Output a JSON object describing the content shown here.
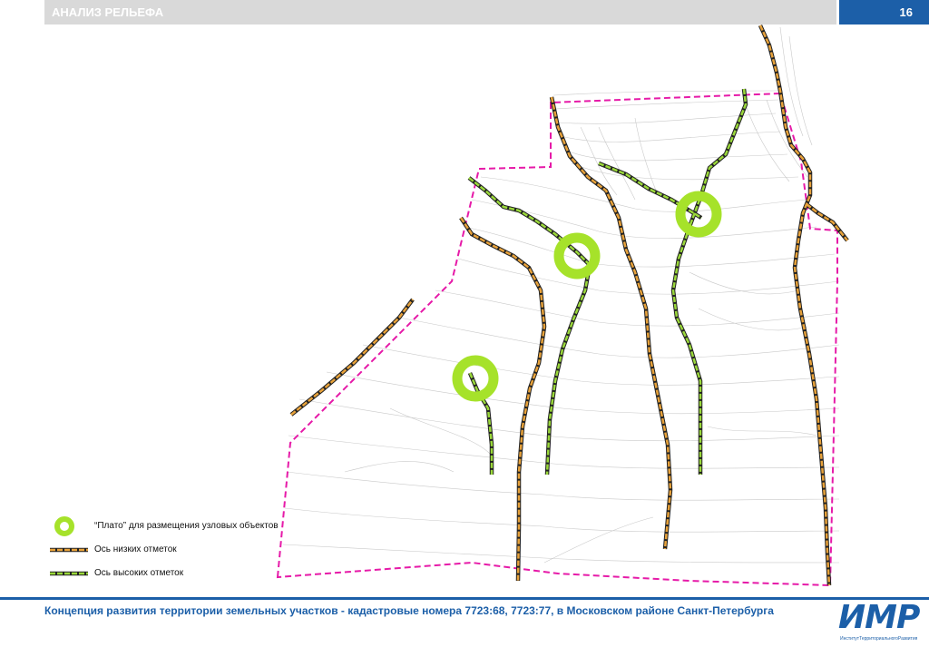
{
  "header": {
    "title": "АНАЛИЗ РЕЛЬЕФА",
    "page_number": "16"
  },
  "legend": {
    "plateau": "“Плато” для размещения узловых объектов",
    "low_axis": "Ось низких отметок",
    "high_axis": "Ось высоких отметок"
  },
  "colors": {
    "boundary": "#e61aa8",
    "plateau": "#a6e22a",
    "low_axis": "#e8a23a",
    "high_axis": "#9ad83a",
    "accent": "#1c5fa8"
  },
  "footer": {
    "text": "Концепция развития территории земельных участков - кадастровые номера 7723:68, 7723:77, в Московском районе  Санкт-Петербурга"
  },
  "logo": {
    "mark": "ИМР",
    "subtitle": "ИнститутТерриториальногоРазвития"
  }
}
